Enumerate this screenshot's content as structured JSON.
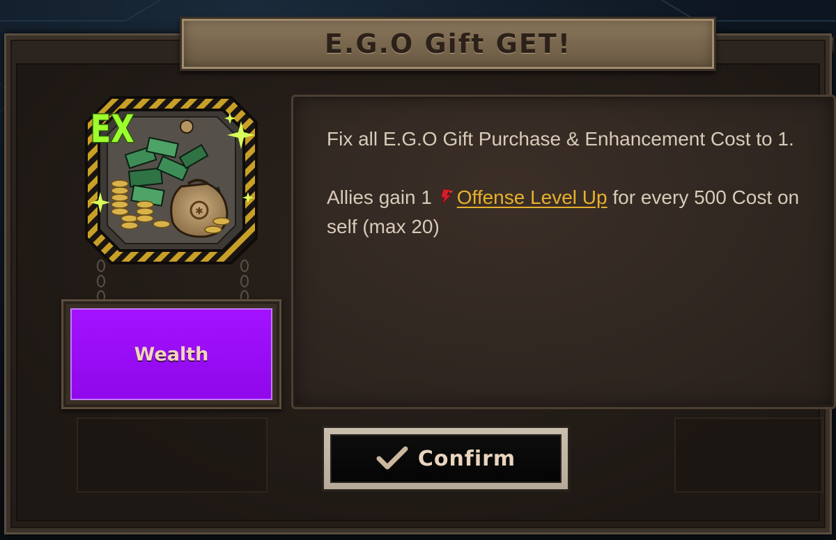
{
  "dialog": {
    "title": "E.G.O Gift GET!"
  },
  "gift": {
    "icon": "money-bag-icon",
    "tier_badge": "EX",
    "keyword": "Wealth",
    "keyword_color": "#9b0cf7"
  },
  "description": {
    "paragraph_1": "Fix all E.G.O Gift Purchase & Enhancement Cost to 1.",
    "paragraph_2_prefix": "Allies gain 1",
    "status_icon": "offense-level-up-icon",
    "status_name": "Offense Level Up",
    "paragraph_2_suffix": "for every 500 Cost on self (max 20)",
    "highlight_color": "#e8b12d"
  },
  "confirm": {
    "icon": "checkmark-icon",
    "label": "Confirm"
  }
}
